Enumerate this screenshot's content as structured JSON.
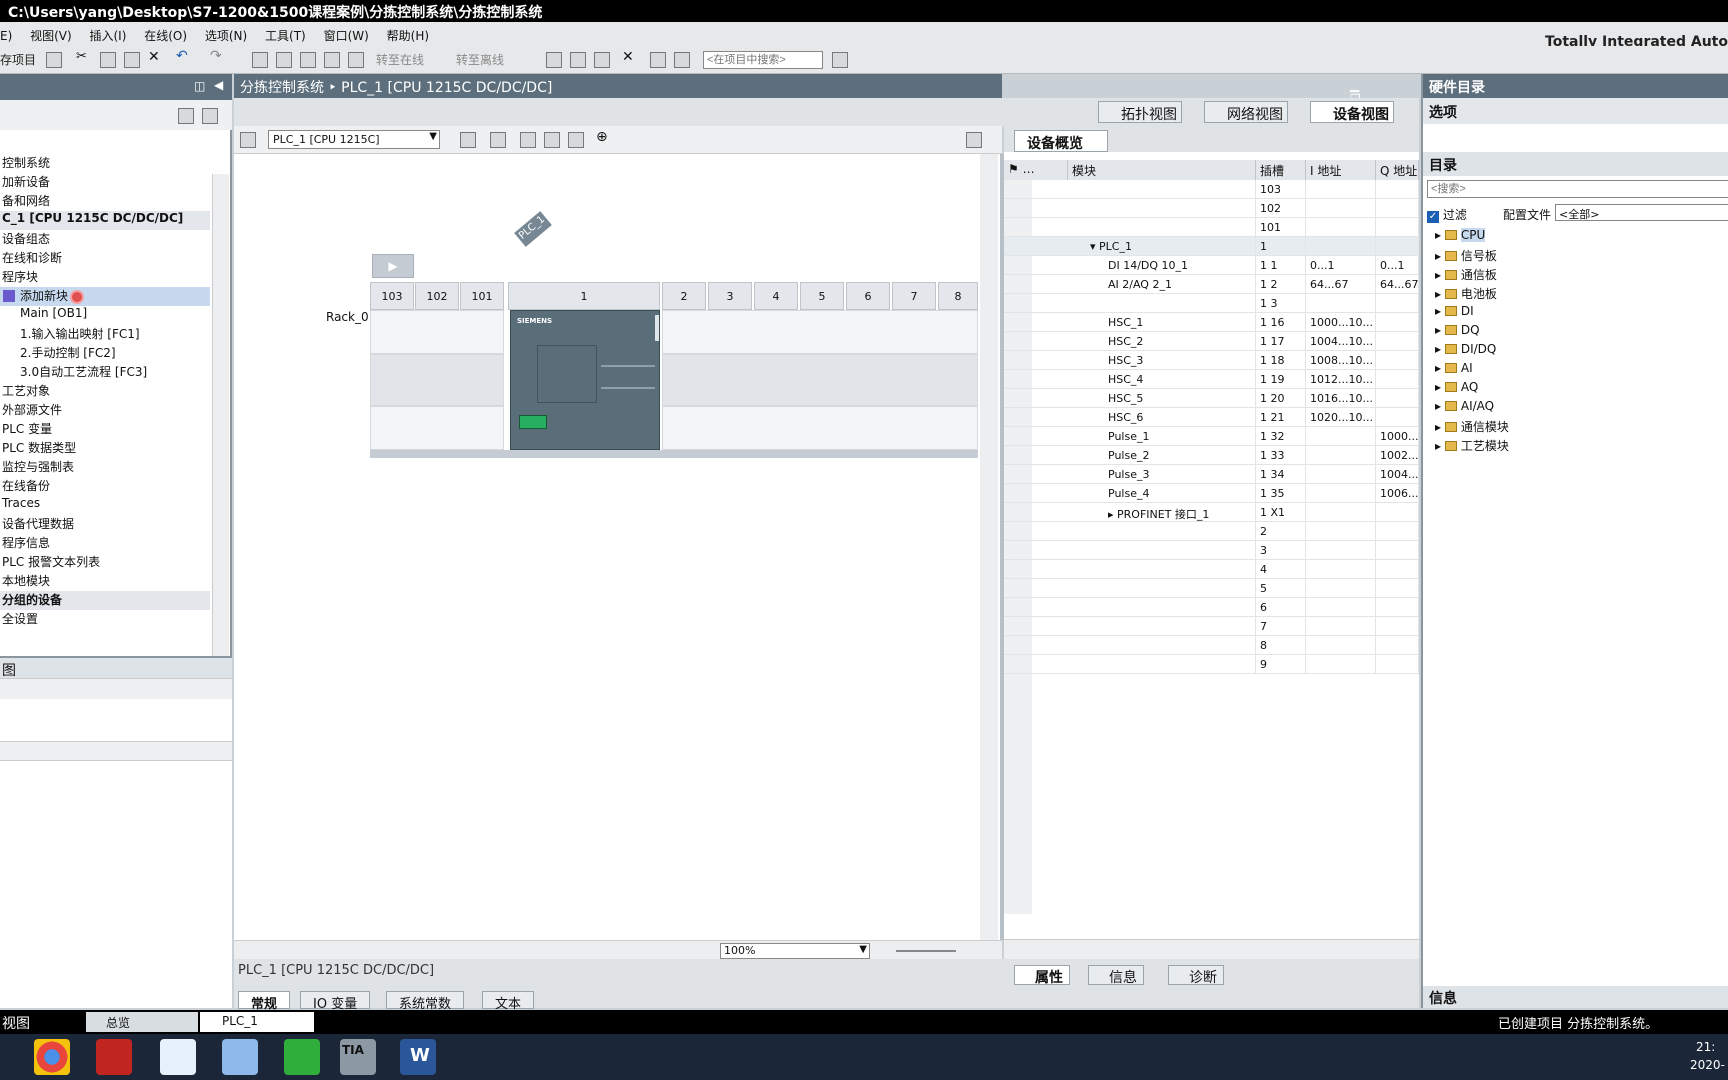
{
  "titlebar": {
    "path": "C:\\Users\\yang\\Desktop\\S7-1200&1500课程案例\\分拣控制系统\\分拣控制系统"
  },
  "menubar": {
    "items": [
      "E)",
      "视图(V)",
      "插入(I)",
      "在线(O)",
      "选项(N)",
      "工具(T)",
      "窗口(W)",
      "帮助(H)"
    ]
  },
  "brand": "Totally Integrated Auto",
  "toolbar": {
    "save_label": "存项目",
    "go_online": "转至在线",
    "go_offline": "转至离线",
    "search_placeholder": "<在项目中搜索>"
  },
  "project_tree": {
    "rows": [
      {
        "label": "控制系统",
        "bold": false
      },
      {
        "label": "加新设备",
        "bold": false
      },
      {
        "label": "备和网络",
        "bold": false
      },
      {
        "label": "C_1 [CPU 1215C DC/DC/DC]",
        "bold": true
      },
      {
        "label": "设备组态",
        "bold": false
      },
      {
        "label": "在线和诊断",
        "bold": false
      },
      {
        "label": "程序块",
        "bold": false
      },
      {
        "label": "添加新块",
        "bold": false,
        "selected": true
      },
      {
        "label": "Main [OB1]",
        "bold": false
      },
      {
        "label": "1.输入输出映射 [FC1]",
        "bold": false
      },
      {
        "label": "2.手动控制 [FC2]",
        "bold": false
      },
      {
        "label": "3.0自动工艺流程 [FC3]",
        "bold": false
      },
      {
        "label": "工艺对象",
        "bold": false
      },
      {
        "label": "外部源文件",
        "bold": false
      },
      {
        "label": "PLC 变量",
        "bold": false
      },
      {
        "label": "PLC 数据类型",
        "bold": false
      },
      {
        "label": "监控与强制表",
        "bold": false
      },
      {
        "label": "在线备份",
        "bold": false
      },
      {
        "label": "Traces",
        "bold": false
      },
      {
        "label": "设备代理数据",
        "bold": false
      },
      {
        "label": "程序信息",
        "bold": false
      },
      {
        "label": "PLC 报警文本列表",
        "bold": false
      },
      {
        "label": "本地模块",
        "bold": false
      },
      {
        "label": "分组的设备",
        "bold": true
      },
      {
        "label": "全设置",
        "bold": false
      }
    ],
    "bottom_section": "图"
  },
  "editor": {
    "breadcrumb": "分拣控制系统 ‣ PLC_1 [CPU 1215C DC/DC/DC]",
    "tabs": [
      "拓扑视图",
      "网络视图",
      "设备视图"
    ],
    "device_select": "PLC_1 [CPU 1215C]",
    "plc_tag": "PLC_1",
    "rack_label": "Rack_0",
    "slots": [
      "103",
      "102",
      "101",
      "1",
      "2",
      "3",
      "4",
      "5",
      "6",
      "7",
      "8"
    ],
    "cpu_brand": "SIEMENS",
    "zoom": "100%"
  },
  "overview": {
    "tab": "设备概览",
    "headers": {
      "module": "模块",
      "slot": "插槽",
      "i_addr": "I 地址",
      "q_addr": "Q 地址"
    },
    "rows": [
      {
        "module": "",
        "slot": "103",
        "i": "",
        "q": "",
        "indent": 0
      },
      {
        "module": "",
        "slot": "102",
        "i": "",
        "q": "",
        "indent": 0
      },
      {
        "module": "",
        "slot": "101",
        "i": "",
        "q": "",
        "indent": 0
      },
      {
        "module": "PLC_1",
        "slot": "1",
        "i": "",
        "q": "",
        "indent": 1,
        "expander": "▾"
      },
      {
        "module": "DI 14/DQ 10_1",
        "slot": "1 1",
        "i": "0...1",
        "q": "0...1",
        "indent": 2
      },
      {
        "module": "AI 2/AQ 2_1",
        "slot": "1 2",
        "i": "64...67",
        "q": "64...67",
        "indent": 2
      },
      {
        "module": "",
        "slot": "1 3",
        "i": "",
        "q": "",
        "indent": 2
      },
      {
        "module": "HSC_1",
        "slot": "1 16",
        "i": "1000...10...",
        "q": "",
        "indent": 2
      },
      {
        "module": "HSC_2",
        "slot": "1 17",
        "i": "1004...10...",
        "q": "",
        "indent": 2
      },
      {
        "module": "HSC_3",
        "slot": "1 18",
        "i": "1008...10...",
        "q": "",
        "indent": 2
      },
      {
        "module": "HSC_4",
        "slot": "1 19",
        "i": "1012...10...",
        "q": "",
        "indent": 2
      },
      {
        "module": "HSC_5",
        "slot": "1 20",
        "i": "1016...10...",
        "q": "",
        "indent": 2
      },
      {
        "module": "HSC_6",
        "slot": "1 21",
        "i": "1020...10...",
        "q": "",
        "indent": 2
      },
      {
        "module": "Pulse_1",
        "slot": "1 32",
        "i": "",
        "q": "1000...",
        "indent": 2
      },
      {
        "module": "Pulse_2",
        "slot": "1 33",
        "i": "",
        "q": "1002...",
        "indent": 2
      },
      {
        "module": "Pulse_3",
        "slot": "1 34",
        "i": "",
        "q": "1004...",
        "indent": 2
      },
      {
        "module": "Pulse_4",
        "slot": "1 35",
        "i": "",
        "q": "1006...",
        "indent": 2
      },
      {
        "module": "PROFINET 接口_1",
        "slot": "1 X1",
        "i": "",
        "q": "",
        "indent": 2,
        "expander": "▸"
      },
      {
        "module": "",
        "slot": "2",
        "i": "",
        "q": "",
        "indent": 0
      },
      {
        "module": "",
        "slot": "3",
        "i": "",
        "q": "",
        "indent": 0
      },
      {
        "module": "",
        "slot": "4",
        "i": "",
        "q": "",
        "indent": 0
      },
      {
        "module": "",
        "slot": "5",
        "i": "",
        "q": "",
        "indent": 0
      },
      {
        "module": "",
        "slot": "6",
        "i": "",
        "q": "",
        "indent": 0
      },
      {
        "module": "",
        "slot": "7",
        "i": "",
        "q": "",
        "indent": 0
      },
      {
        "module": "",
        "slot": "8",
        "i": "",
        "q": "",
        "indent": 0
      },
      {
        "module": "",
        "slot": "9",
        "i": "",
        "q": "",
        "indent": 0
      }
    ]
  },
  "catalog": {
    "title": "硬件目录",
    "options": "选项",
    "directory": "目录",
    "search_placeholder": "<搜索>",
    "filter_label": "过滤",
    "profile_label": "配置文件",
    "profile_value": "<全部>",
    "items": [
      "CPU",
      "信号板",
      "通信板",
      "电池板",
      "DI",
      "DQ",
      "DI/DQ",
      "AI",
      "AQ",
      "AI/AQ",
      "通信模块",
      "工艺模块"
    ],
    "info": "信息"
  },
  "properties": {
    "title": "PLC_1 [CPU 1215C DC/DC/DC]",
    "tabs": [
      "常规",
      "IO 变量",
      "系统常数",
      "文本"
    ],
    "right_tabs": [
      "属性",
      "信息",
      "诊断"
    ]
  },
  "portal": {
    "view_label": "视图",
    "overview": "总览",
    "plc": "PLC_1",
    "status": "已创建项目 分拣控制系统。"
  },
  "taskbar": {
    "clock": "21:",
    "date": "2020-"
  }
}
